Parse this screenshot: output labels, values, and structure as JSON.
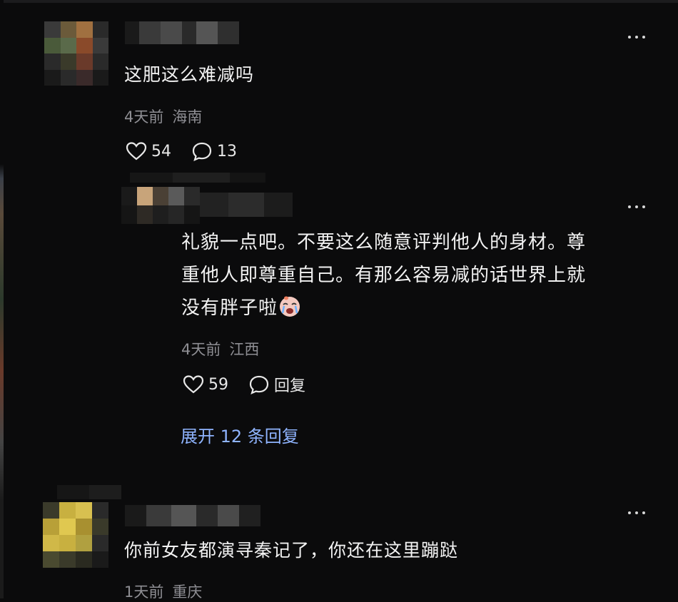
{
  "comments": [
    {
      "text": "这肥这么难减吗",
      "time": "4天前",
      "location": "海南",
      "likes": "54",
      "replies": "13",
      "avatar_colors": [
        "#3a3a3a",
        "#6b5a3a",
        "#a07040",
        "#2a2a2a",
        "#4a4a3a",
        "#5a6a4a",
        "#8a4a2a",
        "#3a3a3a",
        "#2a2a2a",
        "#3a3a2a",
        "#6a3a2a",
        "#2a2a2a",
        "#1a1a1a",
        "#2a2a2a",
        "#3a2a2a",
        "#1a1a1a"
      ]
    },
    {
      "text_lines": [
        "礼貌一点吧。不要这么随意评判他人的身材。尊",
        "重他人即尊重自己。有那么容易减的话世界上就",
        "没有胖子啦"
      ],
      "emoji": "crying-face-emoji",
      "time": "4天前",
      "location": "江西",
      "likes": "59",
      "reply_label": "回复",
      "expand_label": "展开 12 条回复"
    },
    {
      "text": "你前女友都演寻秦记了，你还在这里蹦跶",
      "time": "1天前",
      "location": "重庆"
    }
  ]
}
